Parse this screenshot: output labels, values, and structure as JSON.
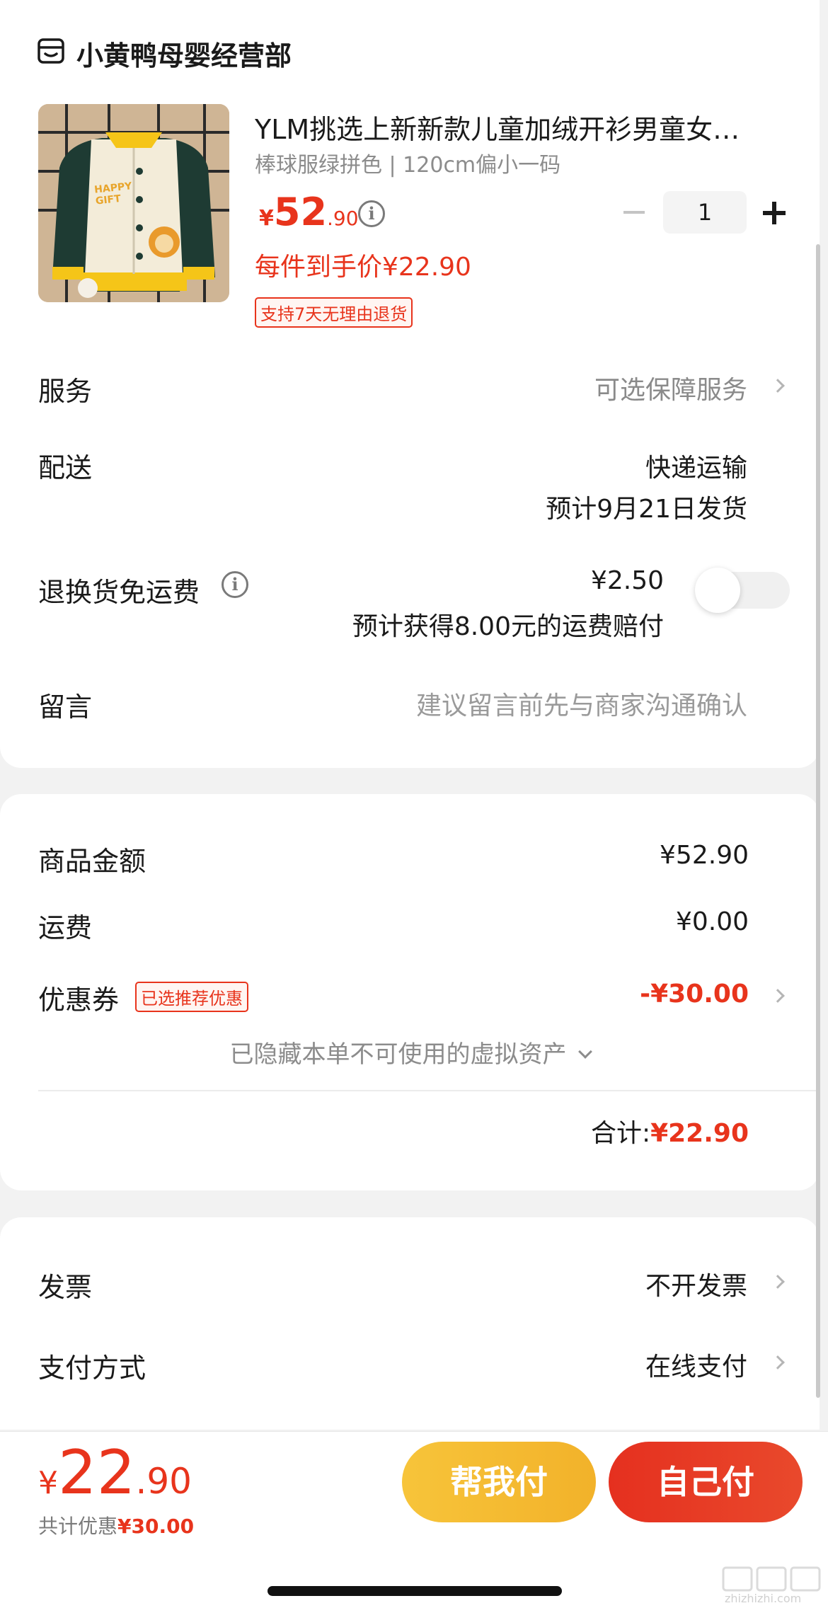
{
  "store": {
    "name": "小黄鸭母婴经营部",
    "icon": "store-icon"
  },
  "product": {
    "title": "YLM挑选上新新款儿童加绒开衫男童女…",
    "spec": "棒球服绿拼色 | 120cm偏小一码",
    "price_symbol": "¥",
    "price_int": "52",
    "price_dec": ".90",
    "final_price": "每件到手价¥22.90",
    "return_tag": "支持7天无理由退货",
    "quantity": "1",
    "image_caption": "HAPPY GIFT"
  },
  "rows": {
    "service_label": "服务",
    "service_value": "可选保障服务",
    "delivery_label": "配送",
    "delivery_method": "快递运输",
    "delivery_date": "预计9月21日发货",
    "return_label": "退换货免运费",
    "return_price": "¥2.50",
    "return_note": "预计获得8.00元的运费赔付",
    "return_toggle_on": false,
    "message_label": "留言",
    "message_placeholder": "建议留言前先与商家沟通确认"
  },
  "summary": {
    "goods_label": "商品金额",
    "goods_value": "¥52.90",
    "shipping_label": "运费",
    "shipping_value": "¥0.00",
    "coupon_label": "优惠券",
    "coupon_tag": "已选推荐优惠",
    "coupon_value": "-¥30.00",
    "hidden_assets": "已隐藏本单不可使用的虚拟资产",
    "total_label": "合计:",
    "total_value": "¥22.90"
  },
  "payment": {
    "invoice_label": "发票",
    "invoice_value": "不开发票",
    "method_label": "支付方式",
    "method_value": "在线支付"
  },
  "bottom": {
    "price_symbol": "¥",
    "price_int": "22",
    "price_dec": ".90",
    "discount_label": "共计优惠",
    "discount_value": "¥30.00",
    "help_pay": "帮我付",
    "self_pay": "自己付"
  },
  "watermark": "zhizhizhi.com",
  "colors": {
    "accent_red": "#e8341c",
    "help_pay_bg": "#f5bc30",
    "self_pay_bg": "#e53a24"
  }
}
